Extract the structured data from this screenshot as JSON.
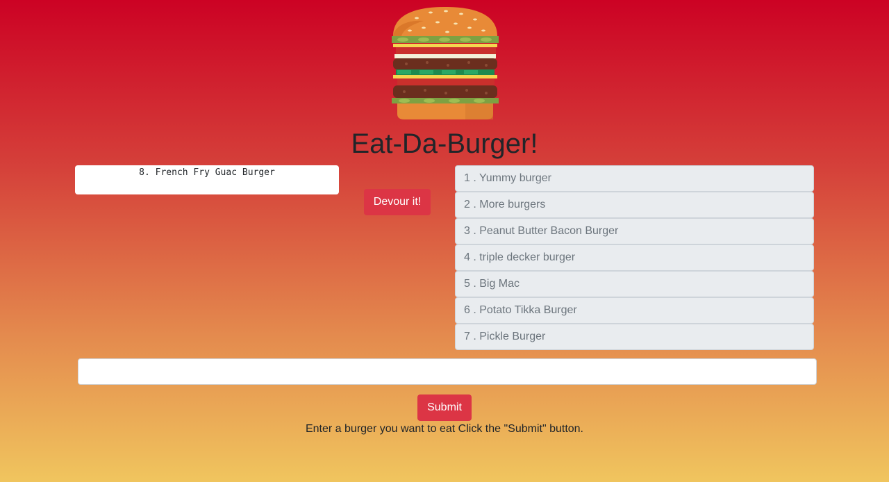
{
  "header": {
    "logo_icon": "burger-icon",
    "title": "Eat-Da-Burger!"
  },
  "uneaten": {
    "items": [
      "8. French Fry Guac Burger"
    ],
    "devour_label": "Devour it!"
  },
  "devoured": {
    "items": [
      "1 . Yummy burger",
      "2 . More burgers",
      "3 . Peanut Butter Bacon Burger",
      "4 . triple decker burger",
      "5 . Big Mac",
      "6 . Potato Tikka Burger",
      "7 . Pickle Burger"
    ]
  },
  "form": {
    "input_value": "",
    "submit_label": "Submit",
    "help_text": "Enter a burger you want to eat Click the \"Submit\" button."
  },
  "colors": {
    "accent": "#dc3545",
    "gradient_top": "#cc0224",
    "gradient_bottom": "#f0c55e"
  }
}
